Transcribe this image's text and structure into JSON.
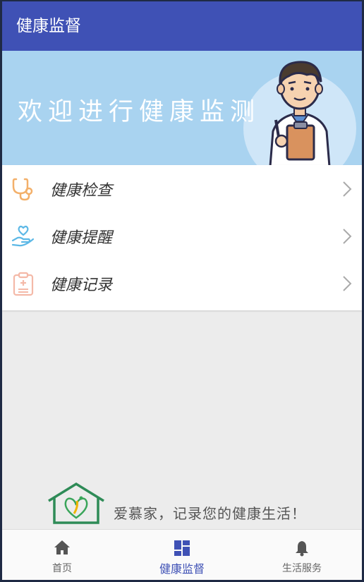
{
  "appbar": {
    "title": "健康监督"
  },
  "banner": {
    "text": "欢迎进行健康监测"
  },
  "menu": {
    "items": [
      {
        "label": "健康检查",
        "icon": "stethoscope-icon"
      },
      {
        "label": "健康提醒",
        "icon": "heart-hand-icon"
      },
      {
        "label": "健康记录",
        "icon": "clipboard-icon"
      }
    ]
  },
  "footer": {
    "slogan": "爱慕家，记录您的健康生活！"
  },
  "bottom_nav": {
    "tabs": [
      {
        "label": "首页",
        "icon": "home-icon"
      },
      {
        "label": "健康监督",
        "icon": "dashboard-icon",
        "active": true
      },
      {
        "label": "生活服务",
        "icon": "bell-icon"
      }
    ]
  },
  "colors": {
    "primary": "#3f51b5",
    "banner": "#a9d3f0"
  }
}
